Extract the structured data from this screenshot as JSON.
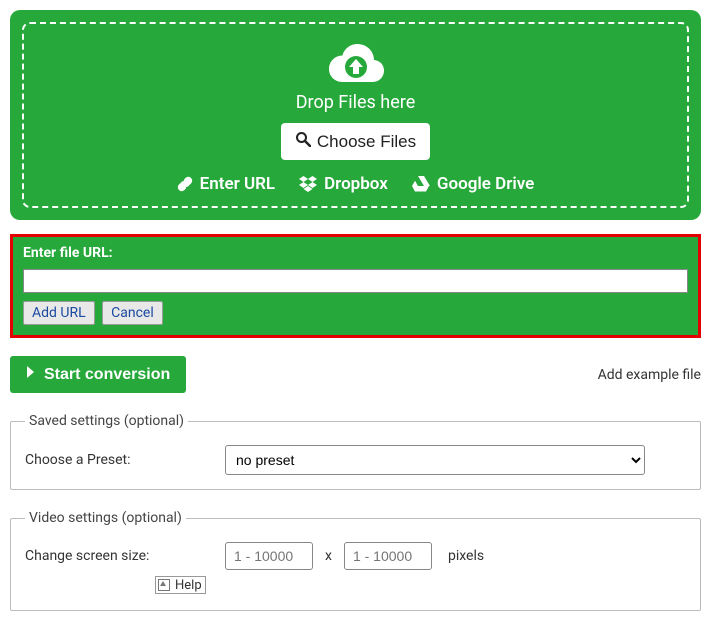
{
  "drop": {
    "heading": "Drop Files here",
    "choose_label": "Choose Files"
  },
  "sources": {
    "enter_url": "Enter URL",
    "dropbox": "Dropbox",
    "google_drive": "Google Drive"
  },
  "url_panel": {
    "label": "Enter file URL:",
    "value": "",
    "add_label": "Add URL",
    "cancel_label": "Cancel"
  },
  "actions": {
    "start_label": "Start conversion",
    "add_example_label": "Add example file"
  },
  "saved_settings": {
    "legend": "Saved settings (optional)",
    "preset_label": "Choose a Preset:",
    "preset_value": "no preset"
  },
  "video_settings": {
    "legend": "Video settings (optional)",
    "screen_size_label": "Change screen size:",
    "size_placeholder": "1 - 10000",
    "pixels_label": "pixels",
    "help_alt": "Help"
  }
}
